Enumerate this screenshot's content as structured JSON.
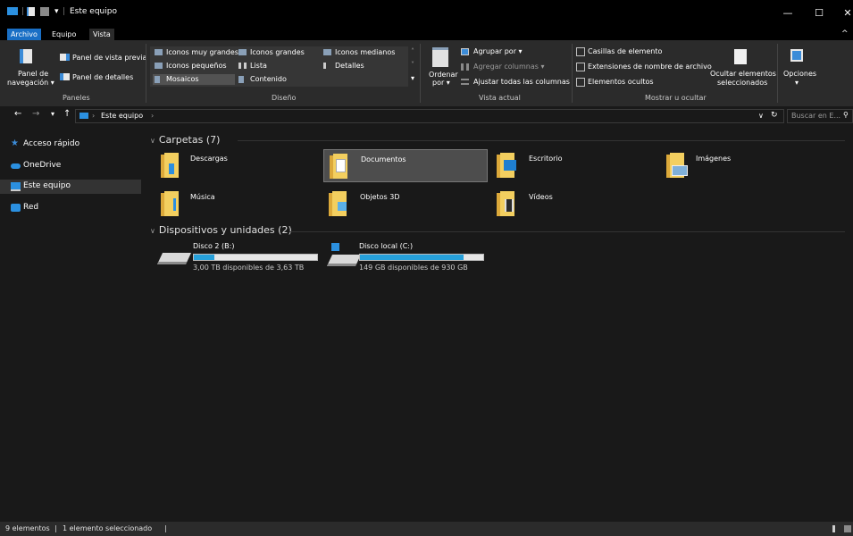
{
  "window": {
    "title": "Este equipo",
    "quick_sep": "|",
    "qa_dropdown": "▾",
    "minimize": "—",
    "maximize": "☐",
    "close": "✕",
    "expand_ribbon": "^"
  },
  "tabs": [
    {
      "label": "Archivo"
    },
    {
      "label": "Equipo"
    },
    {
      "label": "Vista"
    }
  ],
  "ribbon": {
    "paneles": {
      "nav_pane_line1": "Panel de",
      "nav_pane_line2": "navegación ▾",
      "preview_pane": "Panel de vista previa",
      "details_pane": "Panel de detalles",
      "group_label": "Paneles"
    },
    "diseno": {
      "xl_icons": "Iconos muy grandes",
      "large_icons": "Iconos grandes",
      "medium_icons": "Iconos medianos",
      "small_icons": "Iconos pequeños",
      "list": "Lista",
      "details": "Detalles",
      "tiles": "Mosaicos",
      "content": "Contenido",
      "group_label": "Diseño"
    },
    "vista_actual": {
      "sort_line1": "Ordenar",
      "sort_line2": "por ▾",
      "group_by": "Agrupar por ▾",
      "add_columns": "Agregar columnas ▾",
      "fit_columns": "Ajustar todas las columnas",
      "group_label": "Vista actual"
    },
    "mostrar": {
      "item_checkboxes": "Casillas de elemento",
      "file_extensions": "Extensiones de nombre de archivo",
      "hidden_items": "Elementos ocultos",
      "hide_selected_line1": "Ocultar elementos",
      "hide_selected_line2": "seleccionados",
      "group_label": "Mostrar u ocultar"
    },
    "options": {
      "label": "Opciones",
      "arrow": "▾"
    }
  },
  "nav": {
    "back": "←",
    "forward": "→",
    "recent": "▾",
    "up": "↑",
    "breadcrumb_sep": "›",
    "location": "Este equipo",
    "dropdown": "∨",
    "refresh": "↻",
    "search_placeholder": "Buscar en E...",
    "search_icon": "⚲"
  },
  "sidebar": {
    "items": [
      {
        "label": "Acceso rápido",
        "icon": "star-icon"
      },
      {
        "label": "OneDrive",
        "icon": "cloud-icon"
      },
      {
        "label": "Este equipo",
        "icon": "computer-icon"
      },
      {
        "label": "Red",
        "icon": "network-icon"
      }
    ]
  },
  "main": {
    "folders_header": "Carpetas (7)",
    "folders": [
      {
        "label": "Descargas",
        "icon": "downloads-folder-icon"
      },
      {
        "label": "Documentos",
        "icon": "documents-folder-icon"
      },
      {
        "label": "Escritorio",
        "icon": "desktop-folder-icon"
      },
      {
        "label": "Imágenes",
        "icon": "pictures-folder-icon"
      },
      {
        "label": "Música",
        "icon": "music-folder-icon"
      },
      {
        "label": "Objetos 3D",
        "icon": "3d-objects-folder-icon"
      },
      {
        "label": "Vídeos",
        "icon": "videos-folder-icon"
      }
    ],
    "drives_header": "Dispositivos y unidades (2)",
    "drives": [
      {
        "label": "Disco 2 (B:)",
        "free": "3,00 TB disponibles de 3,63 TB",
        "used_fraction": 0.17
      },
      {
        "label": "Disco local (C:)",
        "free": "149 GB disponibles de 930 GB",
        "used_fraction": 0.84
      }
    ]
  },
  "status": {
    "count": "9 elementos",
    "sep1": "|",
    "selected": "1 elemento seleccionado",
    "sep2": "|"
  },
  "colors": {
    "accent": "#1a6fc5",
    "drive_fill": "#26a0da",
    "folder_yellow": "#f3cf5f"
  }
}
